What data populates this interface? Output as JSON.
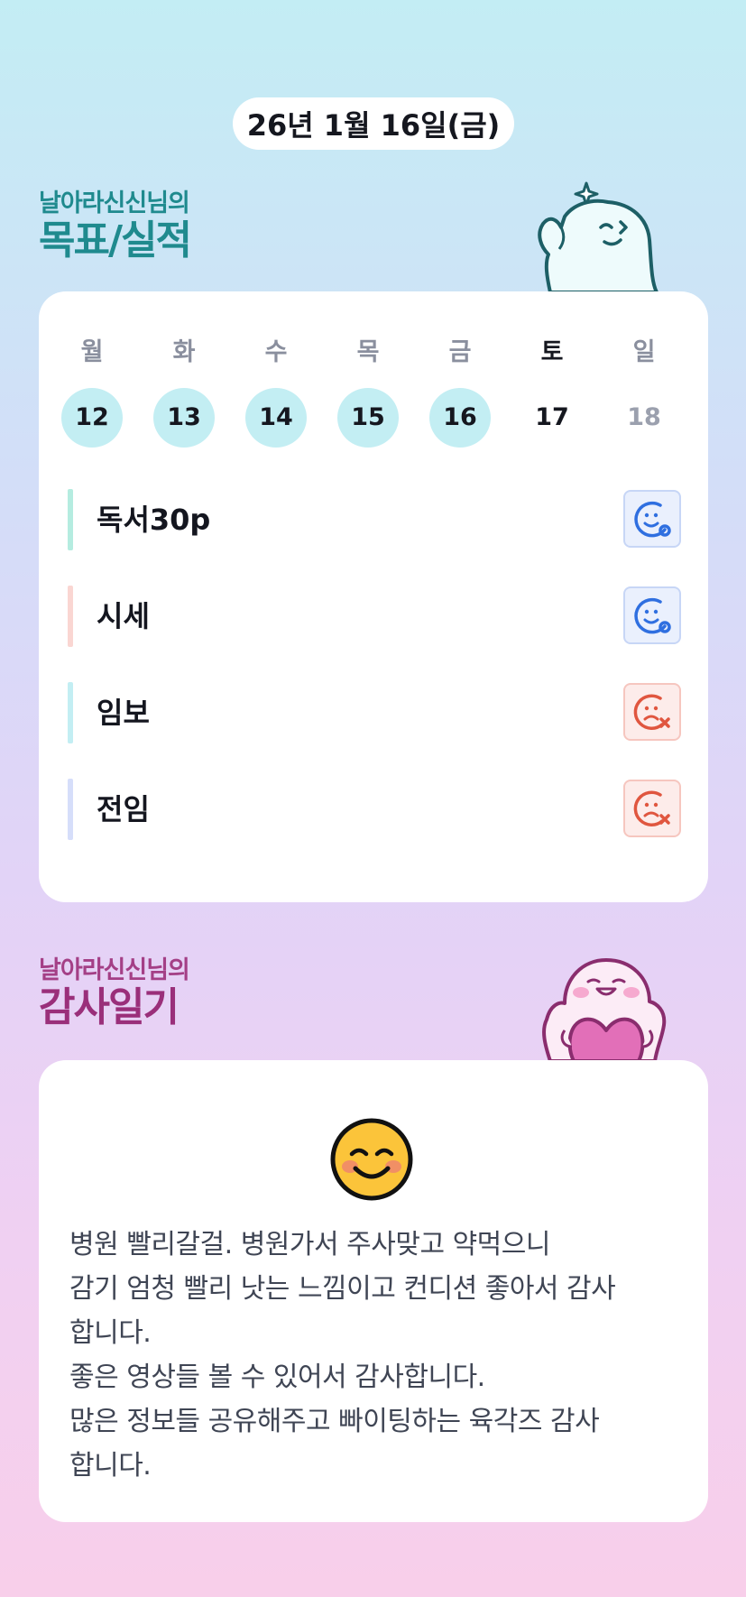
{
  "date": "26년 1월 16일(금)",
  "goals_section": {
    "owner": "날아라신신님의",
    "title": "목표/실적"
  },
  "week": {
    "days": [
      {
        "weekday": "월",
        "date": "12",
        "done": true
      },
      {
        "weekday": "화",
        "date": "13",
        "done": true
      },
      {
        "weekday": "수",
        "date": "14",
        "done": true
      },
      {
        "weekday": "목",
        "date": "15",
        "done": true
      },
      {
        "weekday": "금",
        "date": "16",
        "done": true
      },
      {
        "weekday": "토",
        "date": "17",
        "done": false
      },
      {
        "weekday": "일",
        "date": "18",
        "done": false
      }
    ]
  },
  "goals": [
    {
      "label": "독서30p",
      "accent": "#b5ece0",
      "status": "achieved-icon"
    },
    {
      "label": "시세",
      "accent": "#fad6d2",
      "status": "achieved-icon"
    },
    {
      "label": "임보",
      "accent": "#c3eef3",
      "status": "missed-icon"
    },
    {
      "label": "전임",
      "accent": "#d6defa",
      "status": "missed-icon"
    }
  ],
  "thanks_section": {
    "owner": "날아라신신님의",
    "title": "감사일기"
  },
  "diary": {
    "mood_icon": "smiling-face-icon",
    "text": "병원 빨리갈걸. 병원가서 주사맞고 약먹으니\n감기 엄청 빨리 낫는 느낌이고 컨디션 좋아서 감사\n합니다.\n좋은 영상들 볼 수 있어서 감사합니다.\n많은 정보들 공유해주고 빠이팅하는 육각즈 감사\n합니다."
  },
  "colors": {
    "goals_title": "#1f8a8e",
    "thanks_title": "#9a2f7a",
    "done_day": "#c3eef3",
    "achieved": "#2f6fe0",
    "missed": "#e0563f"
  }
}
